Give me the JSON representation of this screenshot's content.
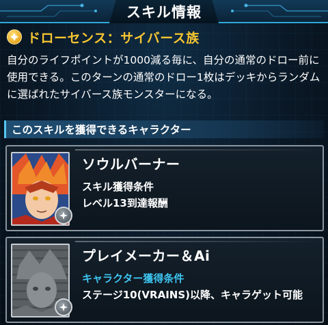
{
  "header": {
    "title": "スキル情報"
  },
  "skill": {
    "icon": "diamond-badge-icon",
    "name": "ドローセンス：サイバース族",
    "description": "自分のライフポイントが1000減る毎に、自分の通常のドロー前に使用できる。このターンの通常のドロー1枚はデッキからランダムに選ばれたサイバース族モンスターになる。"
  },
  "section": {
    "title": "このスキルを獲得できるキャラクター"
  },
  "characters": [
    {
      "name": "ソウルバーナー",
      "condition_label": "スキル獲得条件",
      "condition_value": "レベル13到達報酬",
      "locked": false
    },
    {
      "name": "プレイメーカー＆Ai",
      "condition_label": "キャラクター獲得条件",
      "condition_value": "ステージ10(VRAINS)以降、キャラゲット可能",
      "locked": true
    }
  ],
  "colors": {
    "accent_gold": "#f6c531",
    "accent_cyan": "#3ec5f0",
    "header_border": "#2fa8d8"
  }
}
